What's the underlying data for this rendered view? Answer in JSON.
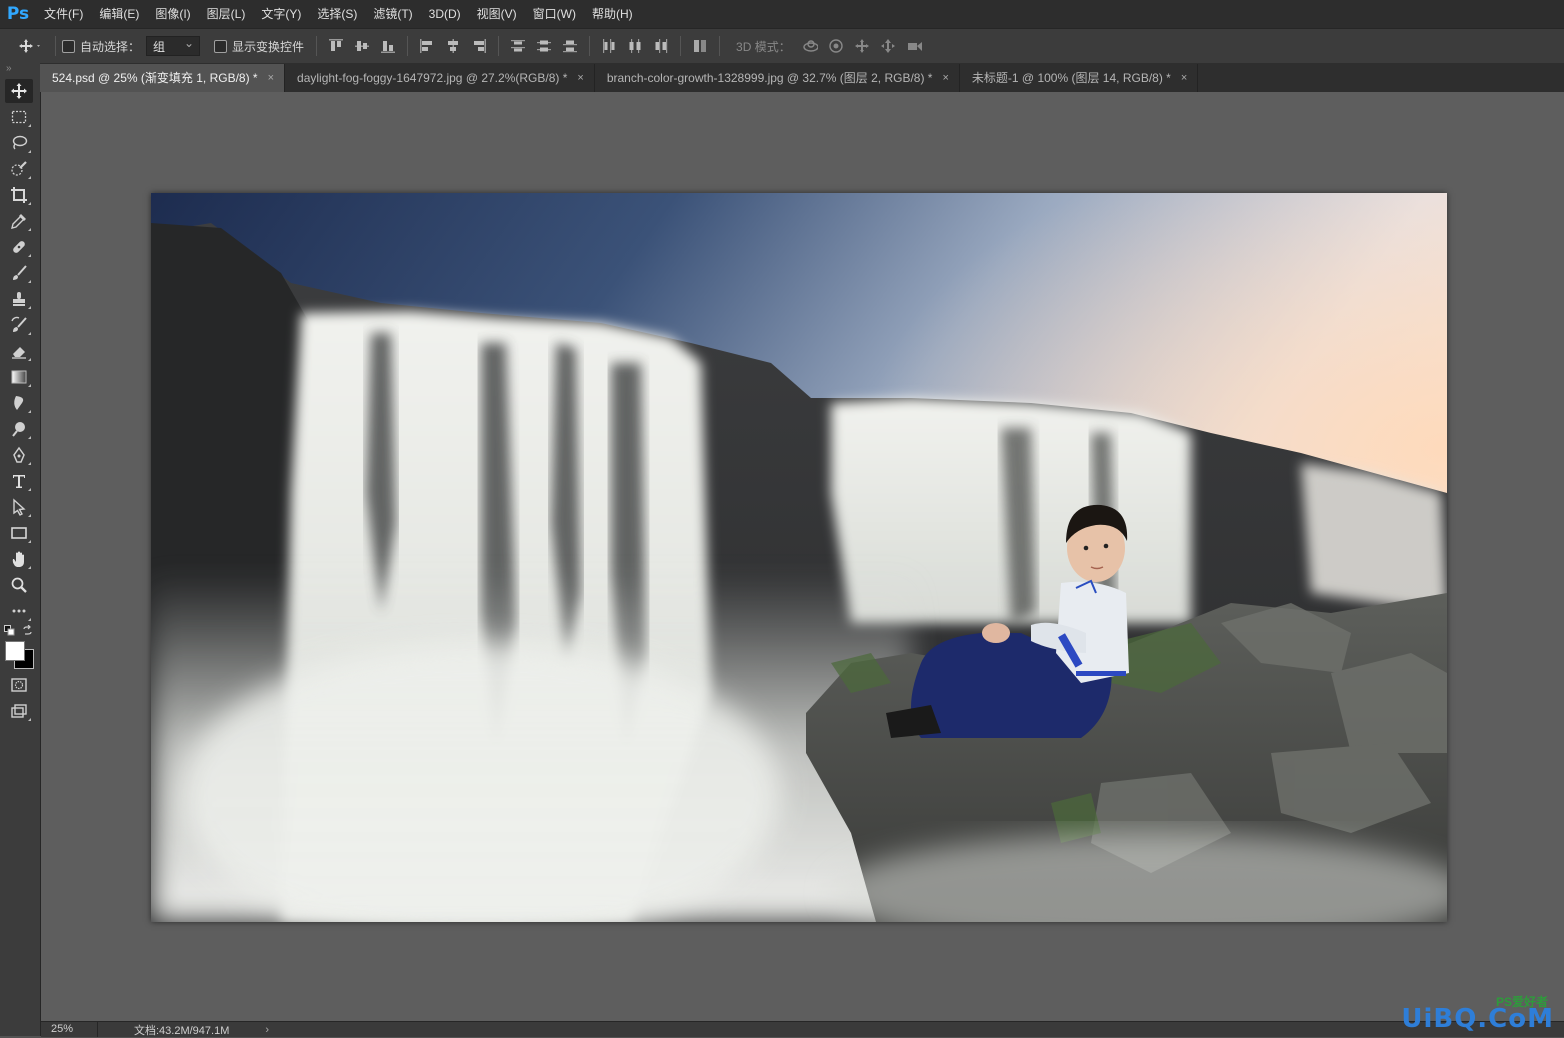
{
  "app": {
    "logo": "Ps"
  },
  "menu": [
    "文件(F)",
    "编辑(E)",
    "图像(I)",
    "图层(L)",
    "文字(Y)",
    "选择(S)",
    "滤镜(T)",
    "3D(D)",
    "视图(V)",
    "窗口(W)",
    "帮助(H)"
  ],
  "options": {
    "auto_select_label": "自动选择：",
    "auto_select_value": "组",
    "show_transform_label": "显示变换控件",
    "mode_3d_label": "3D 模式："
  },
  "tabs": [
    {
      "label": "524.psd @ 25% (渐变填充 1, RGB/8) *",
      "close": "×",
      "active": true
    },
    {
      "label": "daylight-fog-foggy-1647972.jpg @ 27.2%(RGB/8) *",
      "close": "×",
      "active": false
    },
    {
      "label": "branch-color-growth-1328999.jpg @ 32.7% (图层 2, RGB/8) *",
      "close": "×",
      "active": false
    },
    {
      "label": "未标题-1 @ 100% (图层 14, RGB/8) *",
      "close": "×",
      "active": false
    }
  ],
  "tools": [
    "move-tool",
    "marquee-tool",
    "lasso-tool",
    "quick-select-tool",
    "crop-tool",
    "eyedropper-tool",
    "healing-tool",
    "brush-tool",
    "stamp-tool",
    "history-brush-tool",
    "eraser-tool",
    "gradient-tool",
    "blur-tool",
    "dodge-tool",
    "pen-tool",
    "type-tool",
    "path-select-tool",
    "rectangle-tool",
    "hand-tool",
    "zoom-tool",
    "more-tools"
  ],
  "status": {
    "zoom": "25%",
    "doc_info": "文档:43.2M/947.1M",
    "arrow": "›"
  },
  "watermark": {
    "main": "UiBQ.CoM",
    "top": "PS爱好者"
  },
  "colors": {
    "foreground": "#ffffff",
    "background": "#000000",
    "accent": "#31a8ff"
  }
}
